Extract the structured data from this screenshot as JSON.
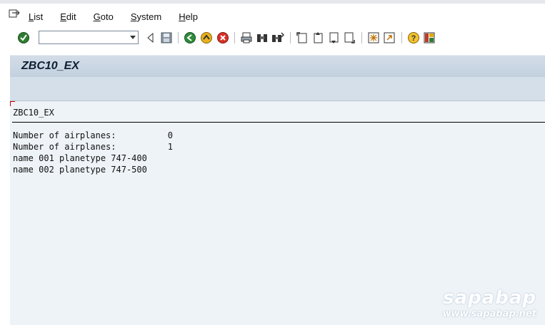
{
  "menu": {
    "items": [
      "List",
      "Edit",
      "Goto",
      "System",
      "Help"
    ]
  },
  "toolbar": {
    "command_field_value": "",
    "icons": [
      "enter-icon",
      "command-dropdown-icon",
      "back-arrow-icon",
      "save-icon",
      "back-icon",
      "exit-icon",
      "cancel-icon",
      "print-icon",
      "find-icon",
      "find-next-icon",
      "first-page-icon",
      "previous-page-icon",
      "next-page-icon",
      "last-page-icon",
      "create-session-icon",
      "shortcut-icon",
      "help-icon",
      "customize-layout-icon"
    ]
  },
  "title": "ZBC10_EX",
  "list": {
    "header": "ZBC10_EX",
    "lines": [
      "Number of airplanes:          0",
      "Number of airplanes:          1",
      "name 001 planetype 747-400",
      "name 002 planetype 747-500"
    ]
  },
  "watermark": {
    "logo": "sapabap",
    "url": "www.sapabap.net"
  },
  "colors": {
    "title_bar": "#c8d5e2",
    "content_bg": "#eef3f7",
    "accent": "#2e7d32"
  }
}
